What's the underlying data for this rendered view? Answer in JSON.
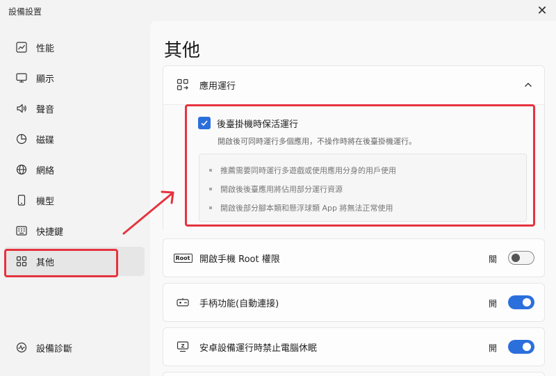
{
  "window": {
    "title": "設備設置",
    "close_symbol": "✕"
  },
  "sidebar": {
    "items": [
      {
        "label": "性能",
        "icon": "performance-chart-icon"
      },
      {
        "label": "顯示",
        "icon": "monitor-icon"
      },
      {
        "label": "聲音",
        "icon": "speaker-icon"
      },
      {
        "label": "磁碟",
        "icon": "disk-pie-icon"
      },
      {
        "label": "網絡",
        "icon": "globe-icon"
      },
      {
        "label": "機型",
        "icon": "phone-icon"
      },
      {
        "label": "快捷鍵",
        "icon": "keyboard-icon"
      },
      {
        "label": "其他",
        "icon": "grid-icon",
        "active": true
      }
    ],
    "footer": {
      "label": "設備診斷",
      "icon": "diagnosis-icon"
    }
  },
  "main": {
    "title": "其他",
    "app_running": {
      "label": "應用運行",
      "expanded": true,
      "checkbox": {
        "label": "後臺掛機時保活運行",
        "checked": true
      },
      "description": "開啟後可同時運行多個應用，不操作時將在後臺掛機運行。",
      "bullets": [
        "推薦需要同時運行多遊戲或使用應用分身的用戶使用",
        "開啟後後臺應用將佔用部分運行資源",
        "開啟後部分腳本類和懸浮球類 App 將無法正常使用"
      ]
    },
    "settings": [
      {
        "label": "開啟手機 Root 權限",
        "state_label": "關",
        "on": false,
        "icon": "root-icon",
        "icon_text": "Root"
      },
      {
        "label": "手柄功能(自動連接)",
        "state_label": "開",
        "on": true,
        "icon": "gamepad-icon"
      },
      {
        "label": "安卓設備運行時禁止電腦休眠",
        "state_label": "開",
        "on": true,
        "icon": "sleep-monitor-icon",
        "icon_text": "Z"
      }
    ]
  },
  "colors": {
    "accent": "#2b6fdd",
    "annotation": "#e5333f"
  }
}
